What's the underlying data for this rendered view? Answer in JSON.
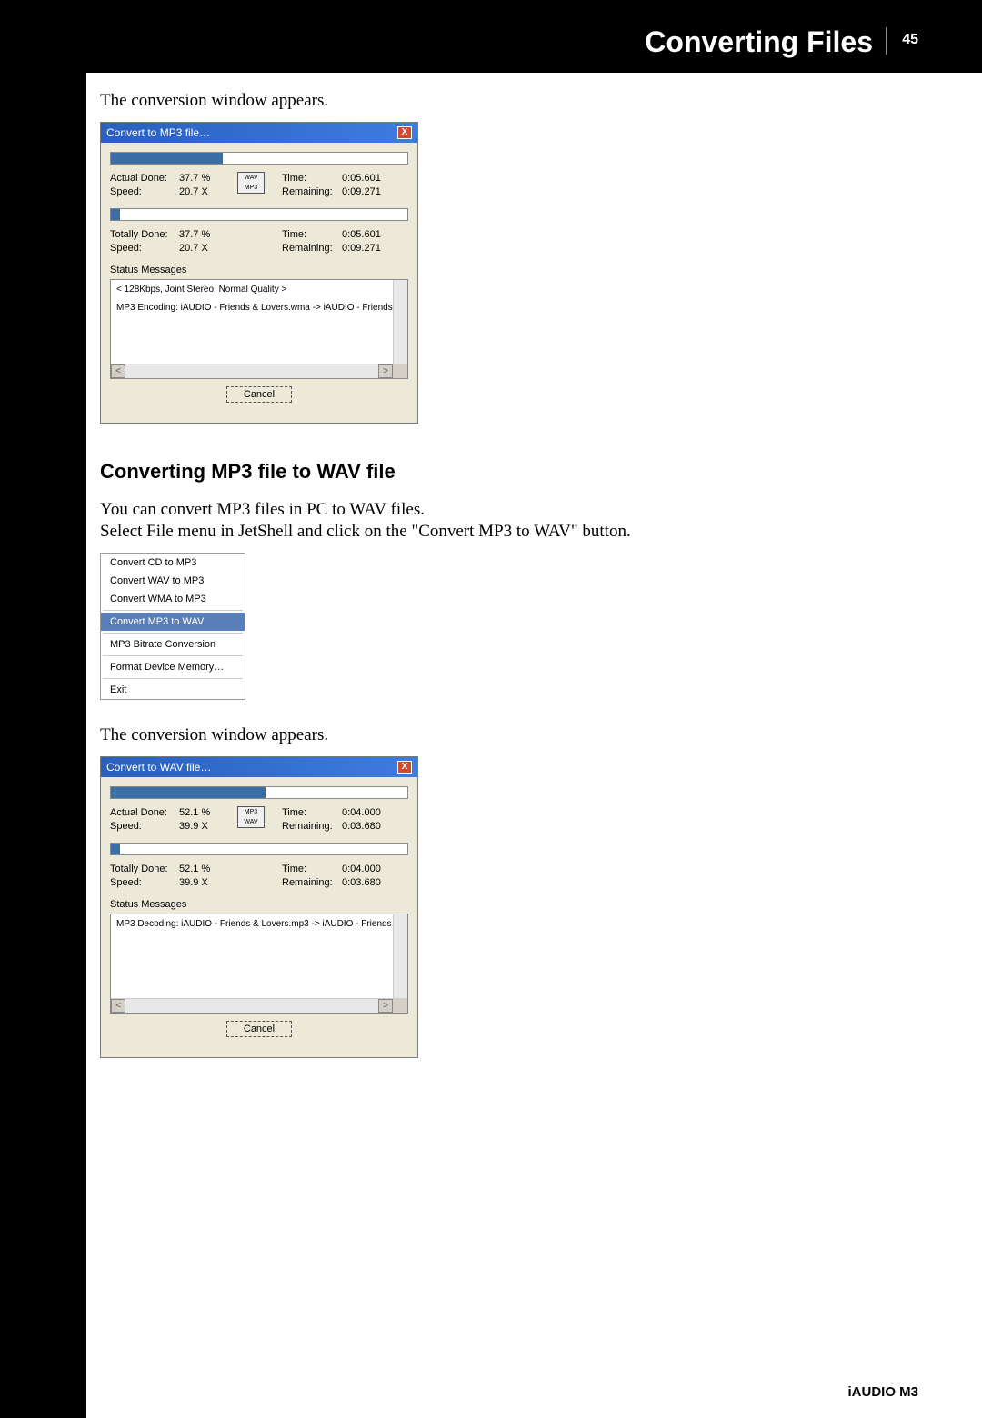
{
  "header": {
    "title": "Converting Files",
    "page": "45"
  },
  "intro1": "The conversion window appears.",
  "dialog1": {
    "title": "Convert to MP3 file…",
    "close": "X",
    "actual": {
      "done_l": "Actual Done:",
      "done_v": "37.7 %",
      "speed_l": "Speed:",
      "speed_v": "20.7 X",
      "time_l": "Time:",
      "time_v": "0:05.601",
      "rem_l": "Remaining:",
      "rem_v": "0:09.271"
    },
    "total": {
      "done_l": "Totally Done:",
      "done_v": "37.7 %",
      "speed_l": "Speed:",
      "speed_v": "20.7 X",
      "time_l": "Time:",
      "time_v": "0:05.601",
      "rem_l": "Remaining:",
      "rem_v": "0:09.271"
    },
    "status_label": "Status Messages",
    "status_lines": {
      "l1": "< 128Kbps, Joint Stereo, Normal Quality >",
      "l2": "MP3 Encoding: iAUDIO - Friends & Lovers.wma  -> iAUDIO - Friends"
    },
    "cancel": "Cancel",
    "icon_top": "WAV",
    "icon_bot": "MP3"
  },
  "section2": {
    "heading": "Converting MP3 file to WAV file",
    "p1": "You can convert MP3 files in PC to WAV files.",
    "p2": "Select File menu in JetShell and click on the \"Convert MP3 to WAV\" button."
  },
  "menu": {
    "i1": "Convert CD to MP3",
    "i2": "Convert WAV to MP3",
    "i3": "Convert WMA to MP3",
    "i4": "Convert MP3 to WAV",
    "i5": "MP3 Bitrate Conversion",
    "i6": "Format Device Memory…",
    "i7": "Exit"
  },
  "intro2": "The conversion window appears.",
  "dialog2": {
    "title": "Convert to WAV file…",
    "close": "X",
    "actual": {
      "done_l": "Actual Done:",
      "done_v": "52.1 %",
      "speed_l": "Speed:",
      "speed_v": "39.9 X",
      "time_l": "Time:",
      "time_v": "0:04.000",
      "rem_l": "Remaining:",
      "rem_v": "0:03.680"
    },
    "total": {
      "done_l": "Totally Done:",
      "done_v": "52.1 %",
      "speed_l": "Speed:",
      "speed_v": "39.9 X",
      "time_l": "Time:",
      "time_v": "0:04.000",
      "rem_l": "Remaining:",
      "rem_v": "0:03.680"
    },
    "status_label": "Status Messages",
    "status_lines": {
      "l1": "MP3 Decoding: iAUDIO - Friends & Lovers.mp3  -> iAUDIO - Friends"
    },
    "cancel": "Cancel",
    "icon_top": "MP3",
    "icon_bot": "WAV"
  },
  "footer": "iAUDIO M3",
  "scroll": {
    "left": "<",
    "right": ">"
  }
}
